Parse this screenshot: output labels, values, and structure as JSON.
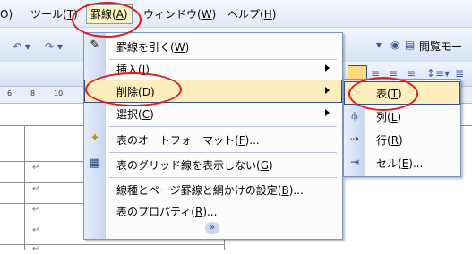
{
  "menubar": {
    "items": [
      {
        "label": "ツール(",
        "key": "T",
        "tail": ")"
      },
      {
        "label": "罫線(",
        "key": "A",
        "tail": ")"
      },
      {
        "label": "ウィンドウ(",
        "key": "W",
        "tail": ")"
      },
      {
        "label": "ヘルプ(",
        "key": "H",
        "tail": ")"
      }
    ],
    "left_fragment": "O)"
  },
  "toolbar": {
    "reading_mode_label": "閲覧モー",
    "undo_icon": "undo-icon",
    "redo_icon": "redo-icon"
  },
  "ruler": {
    "ticks": [
      "6",
      "8",
      "10"
    ]
  },
  "cell_mark": "↵",
  "menu": {
    "items": [
      {
        "label": "罫線を引く(",
        "key": "W",
        "tail": ")",
        "icon": "pencil-icon",
        "arrow": false
      },
      {
        "label": "挿入(",
        "key": "I",
        "tail": ")",
        "icon": "",
        "arrow": true
      },
      {
        "label": "削除(",
        "key": "D",
        "tail": ")",
        "icon": "",
        "arrow": true
      },
      {
        "label": "選択(",
        "key": "C",
        "tail": ")",
        "icon": "",
        "arrow": true
      },
      {
        "label": "表のオートフォーマット(",
        "key": "F",
        "tail": ")...",
        "icon": "autoformat-icon",
        "arrow": false
      },
      {
        "label": "表のグリッド線を表示しない(",
        "key": "G",
        "tail": ")",
        "icon": "grid-icon",
        "arrow": false
      },
      {
        "label": "線種とページ罫線と網かけの設定(",
        "key": "B",
        "tail": ")...",
        "icon": "",
        "arrow": false
      },
      {
        "label": "表のプロパティ(",
        "key": "R",
        "tail": ")...",
        "icon": "",
        "arrow": false
      }
    ]
  },
  "submenu": {
    "items": [
      {
        "label": "表(",
        "key": "T",
        "tail": ")",
        "icon": "table-delete-icon"
      },
      {
        "label": "列(",
        "key": "L",
        "tail": ")",
        "icon": "column-delete-icon"
      },
      {
        "label": "行(",
        "key": "R",
        "tail": ")",
        "icon": "row-delete-icon"
      },
      {
        "label": "セル(",
        "key": "E",
        "tail": ")...",
        "icon": "cell-delete-icon"
      }
    ]
  },
  "colors": {
    "highlight": "#ffeebd",
    "annotation": "#e21b1b",
    "menu_border": "#7a96c0"
  }
}
